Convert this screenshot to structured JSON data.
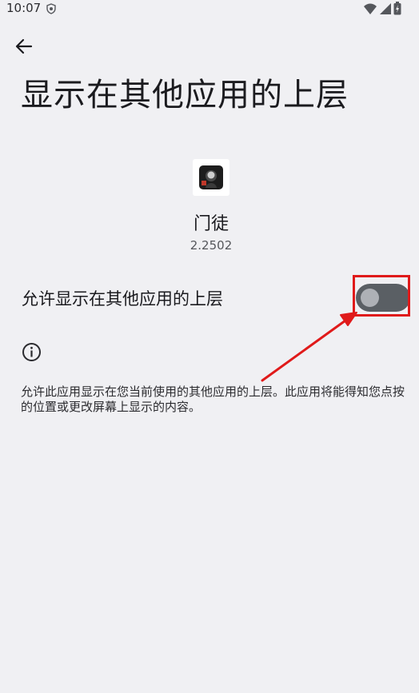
{
  "status_bar": {
    "time": "10:07"
  },
  "header": {
    "back_icon": "arrow-back-icon",
    "title": "显示在其他应用的上层"
  },
  "app": {
    "name": "门徒",
    "version": "2.2502"
  },
  "permission": {
    "label": "允许显示在其他应用的上层",
    "enabled": false
  },
  "info": {
    "icon": "info-icon",
    "description": "允许此应用显示在您当前使用的其他应用的上层。此应用将能得知您点按的位置或更改屏幕上显示的内容。"
  },
  "annotation": {
    "highlight_color": "#e01a1a"
  },
  "colors": {
    "background": "#f0f0f3",
    "switch_off_track": "#5a5f64",
    "switch_off_thumb": "#aeb1b6"
  }
}
